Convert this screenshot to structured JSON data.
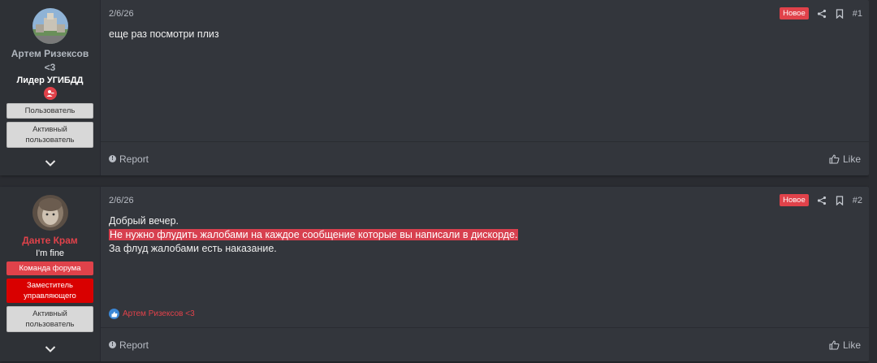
{
  "colors": {
    "accent_red": "#e0424a",
    "dark_red": "#d90000",
    "page_bg": "#2a2c31",
    "post_bg": "#33363c"
  },
  "posts": [
    {
      "date": "2/6/26",
      "new_label": "Новое",
      "number": "#1",
      "author": {
        "name": "Артем Ризексов <3",
        "name_color": "#b0b6be",
        "title": "Лидер УГИБДД",
        "role_icon": "user-minus-icon",
        "badges": [
          {
            "label": "Пользователь",
            "style": "gray"
          },
          {
            "label": "Активный пользователь",
            "style": "gray"
          }
        ]
      },
      "message_lines": [
        "еще раз посмотри плиз"
      ],
      "report_label": "Report",
      "like_label": "Like"
    },
    {
      "date": "2/6/26",
      "new_label": "Новое",
      "number": "#2",
      "author": {
        "name": "Данте Крам",
        "name_color": "#e0424a",
        "title": "I'm fine",
        "badges": [
          {
            "label": "Команда форума",
            "style": "red"
          },
          {
            "label": "Заместитель управляющего",
            "style": "darkred"
          },
          {
            "label": "Активный пользователь",
            "style": "gray"
          }
        ]
      },
      "message_lines": [
        "Добрый вечер.",
        "Не нужно флудить жалобами на каждое сообщение которые вы написали в дискорде.",
        "За флуд жалобами есть наказание."
      ],
      "reaction_user": "Артем Ризексов <3",
      "reaction_icon": "thumbs-up-icon",
      "report_label": "Report",
      "like_label": "Like"
    }
  ]
}
